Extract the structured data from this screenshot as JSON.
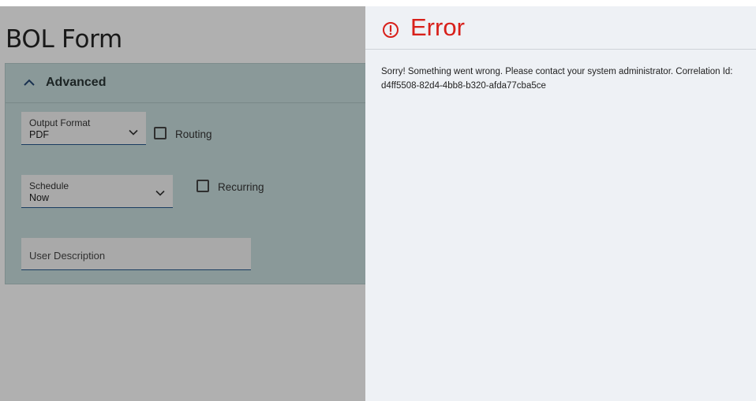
{
  "page": {
    "title": "BOL Form"
  },
  "advanced": {
    "title": "Advanced",
    "output_format": {
      "label": "Output Format",
      "value": "PDF"
    },
    "routing": {
      "label": "Routing",
      "checked": false
    },
    "schedule": {
      "label": "Schedule",
      "value": "Now"
    },
    "recurring": {
      "label": "Recurring",
      "checked": false
    },
    "user_description": {
      "placeholder": "User Description"
    }
  },
  "error_panel": {
    "title": "Error",
    "icon": "error-circle-icon",
    "message": "Sorry! Something went wrong. Please contact your system administrator. Correlation Id: d4ff5508-82d4-4bb8-b320-afda77cba5ce",
    "color": "#d8201a"
  }
}
